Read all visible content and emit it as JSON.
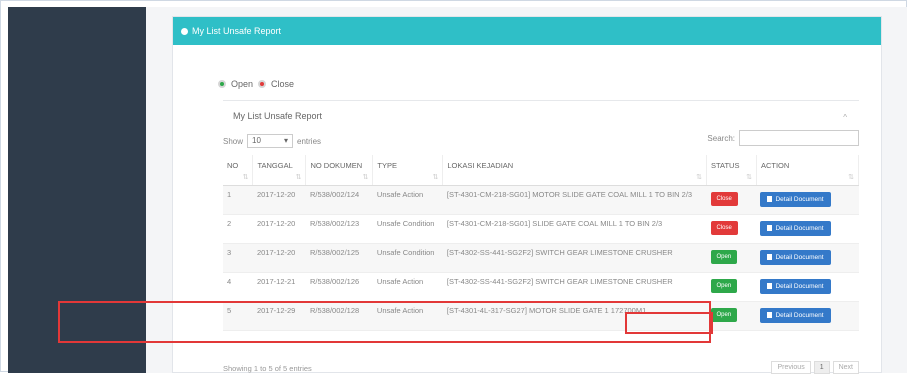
{
  "panel": {
    "title": "My List Unsafe Report"
  },
  "legend": {
    "open_label": "Open",
    "close_label": "Close"
  },
  "box": {
    "title": "My List Unsafe Report",
    "collapse_icon": "chevron-up-icon",
    "show_prefix": "Show",
    "show_value": "10",
    "show_suffix": "entries",
    "search_label": "Search:"
  },
  "table": {
    "headers": [
      "NO",
      "TANGGAL",
      "NO DOKUMEN",
      "TYPE",
      "LOKASI KEJADIAN",
      "STATUS",
      "ACTION"
    ],
    "rows": [
      {
        "no": "1",
        "tanggal": "2017-12-20",
        "dokumen": "R/538/002/124",
        "type": "Unsafe Action",
        "lokasi": "[ST-4301-CM-218-SG01] MOTOR SLIDE GATE COAL MILL 1 TO BIN 2/3",
        "status": "Close",
        "action": "Detail Document"
      },
      {
        "no": "2",
        "tanggal": "2017-12-20",
        "dokumen": "R/538/002/123",
        "type": "Unsafe Condition",
        "lokasi": "[ST-4301-CM-218-SG01] SLIDE GATE COAL MILL 1 TO BIN 2/3",
        "status": "Close",
        "action": "Detail Document"
      },
      {
        "no": "3",
        "tanggal": "2017-12-20",
        "dokumen": "R/538/002/125",
        "type": "Unsafe Condition",
        "lokasi": "[ST-4302-SS-441-SG2F2] SWITCH GEAR LIMESTONE CRUSHER",
        "status": "Open",
        "action": "Detail Document"
      },
      {
        "no": "4",
        "tanggal": "2017-12-21",
        "dokumen": "R/538/002/126",
        "type": "Unsafe Action",
        "lokasi": "[ST-4302-SS-441-SG2F2] SWITCH GEAR LIMESTONE CRUSHER",
        "status": "Open",
        "action": "Detail Document"
      },
      {
        "no": "5",
        "tanggal": "2017-12-29",
        "dokumen": "R/538/002/128",
        "type": "Unsafe Action",
        "lokasi": "[ST-4301-4L-317-SG27] MOTOR SLIDE GATE 1 172700M1",
        "status": "Open",
        "action": "Detail Document"
      }
    ]
  },
  "footer": {
    "info": "Showing 1 to 5 of 5 entries",
    "prev": "Previous",
    "page": "1",
    "next": "Next"
  },
  "colors": {
    "header": "#2fbfc7",
    "sidebar": "#2f3c4b",
    "open": "#2ea84a",
    "close": "#e23a3a",
    "action": "#3479c9",
    "highlight": "#e23838"
  }
}
